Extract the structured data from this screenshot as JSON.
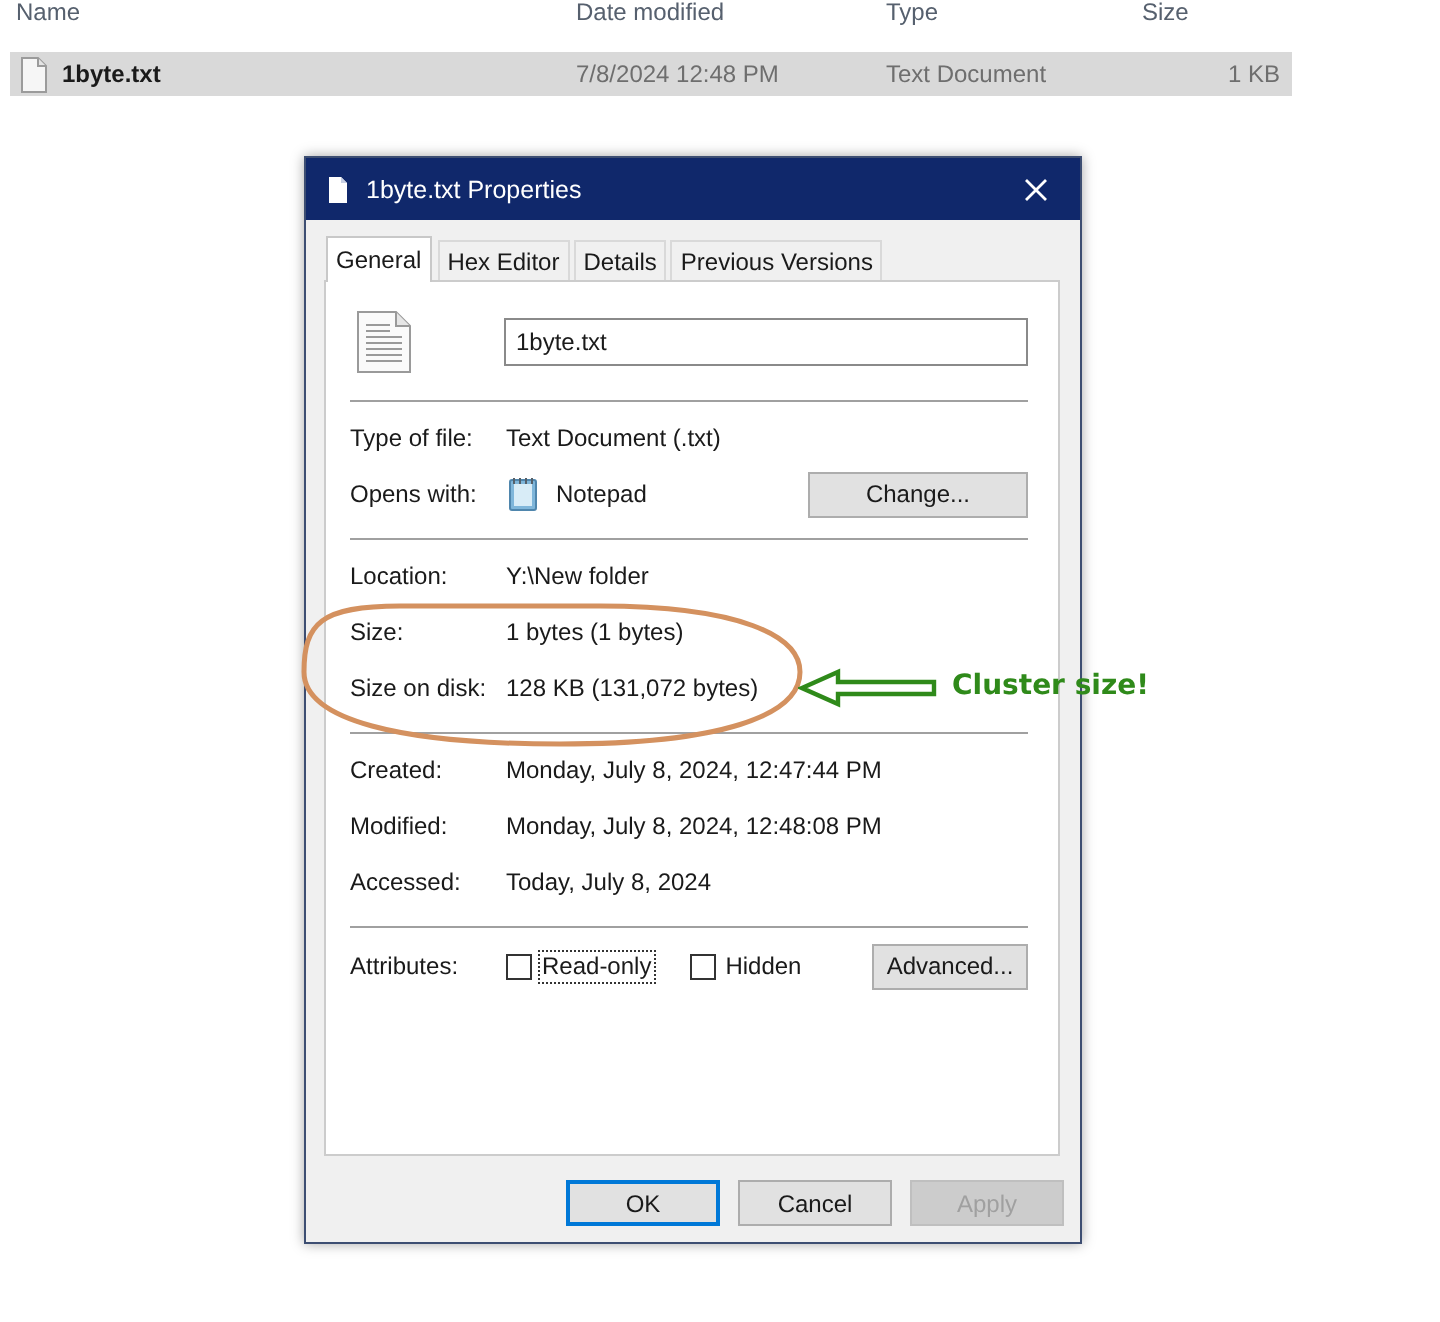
{
  "file_list": {
    "columns": [
      "Name",
      "Date modified",
      "Type",
      "Size"
    ],
    "rows": [
      {
        "name": "1byte.txt",
        "date_modified": "7/8/2024 12:48 PM",
        "type": "Text Document",
        "size": "1 KB",
        "selected": true
      }
    ]
  },
  "dialog": {
    "title": "1byte.txt Properties",
    "tabs": [
      {
        "label": "General",
        "selected": true
      },
      {
        "label": "Hex Editor",
        "selected": false
      },
      {
        "label": "Details",
        "selected": false
      },
      {
        "label": "Previous Versions",
        "selected": false
      }
    ],
    "file_name": "1byte.txt",
    "sections": [
      {
        "rows": [
          {
            "kind": "text",
            "label": "Type of file:",
            "value": "Text Document (.txt)"
          },
          {
            "kind": "app",
            "label": "Opens with:",
            "value": "Notepad",
            "button": {
              "label": "Change..."
            }
          }
        ]
      },
      {
        "rows": [
          {
            "kind": "text",
            "label": "Location:",
            "value": "Y:\\New folder"
          },
          {
            "kind": "text",
            "label": "Size:",
            "value": "1 bytes (1 bytes)"
          },
          {
            "kind": "text",
            "label": "Size on disk:",
            "value": "128 KB (131,072 bytes)"
          }
        ]
      },
      {
        "rows": [
          {
            "kind": "text",
            "label": "Created:",
            "value": "Monday, July 8, 2024, 12:47:44 PM"
          },
          {
            "kind": "text",
            "label": "Modified:",
            "value": "Monday, July 8, 2024, 12:48:08 PM"
          },
          {
            "kind": "text",
            "label": "Accessed:",
            "value": "Today, July 8, 2024"
          }
        ]
      },
      {
        "rows": [
          {
            "kind": "attributes",
            "label": "Attributes:",
            "checkboxes": [
              {
                "label": "Read-only",
                "checked": false,
                "focused": true
              },
              {
                "label": "Hidden",
                "checked": false,
                "focused": false
              }
            ],
            "button": {
              "label": "Advanced..."
            }
          }
        ]
      }
    ],
    "buttons": [
      {
        "label": "OK",
        "default": true,
        "disabled": false
      },
      {
        "label": "Cancel",
        "default": false,
        "disabled": false
      },
      {
        "label": "Apply",
        "default": false,
        "disabled": true
      }
    ]
  },
  "annotation": {
    "label": "Cluster size!"
  }
}
